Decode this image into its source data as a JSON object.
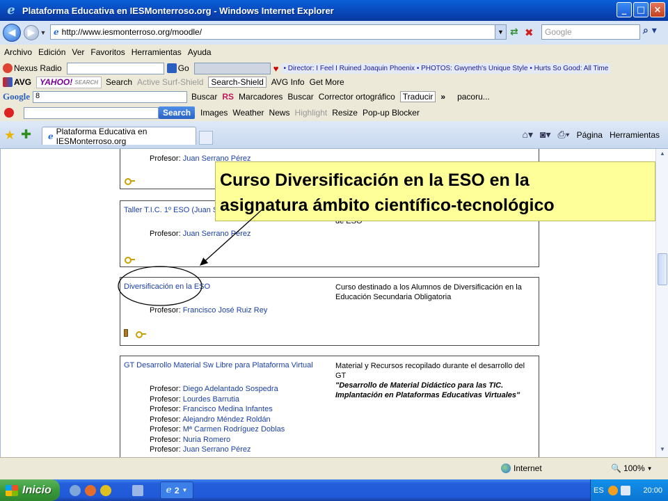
{
  "window": {
    "title": "Plataforma Educativa en IESMonterroso.org - Windows Internet Explorer",
    "buttons": {
      "minimize": "_",
      "maximize": "□",
      "close": "×"
    }
  },
  "address_bar": {
    "url": "http://www.iesmonterroso.org/moodle/",
    "search_placeholder": "Google"
  },
  "menu": [
    "Archivo",
    "Edición",
    "Ver",
    "Favoritos",
    "Herramientas",
    "Ayuda"
  ],
  "toolbar1": {
    "nexus": "Nexus Radio",
    "go": "Go",
    "ticker": "• Director: I Feel I Ruined Joaquin Phoenix • PHOTOS: Gwyneth's Unique Style • Hurts So Good: All Time"
  },
  "toolbar2": {
    "avg": "AVG",
    "yahoo": "YAHOO!",
    "search_hint": "SEARCH",
    "search": "Search",
    "active_surf_shield": "Active Surf-Shield",
    "search_shield": "Search-Shield",
    "avg_info": "AVG Info",
    "get_more": "Get More"
  },
  "toolbar3": {
    "google": "Google",
    "google_field": "8",
    "buscar": "Buscar",
    "rs": "RS",
    "marcadores": "Marcadores",
    "buscar2": "Buscar",
    "corrector": "Corrector ortográfico",
    "traducir": "Traducir",
    "more": "»",
    "user": "pacoru..."
  },
  "toolbar4": {
    "search_btn": "Search",
    "images": "Images",
    "weather": "Weather",
    "news": "News",
    "highlight": "Highlight",
    "resize": "Resize",
    "popup": "Pop-up Blocker"
  },
  "tab": {
    "label": "Plataforma Educativa en IESMonterroso.org"
  },
  "command_bar": {
    "pagina": "Página",
    "herramientas": "Herramientas"
  },
  "courses": [
    {
      "name": "",
      "desc": "",
      "teachers": [
        {
          "label": "Profesor",
          "name": "Juan Serrano Pérez"
        }
      ]
    },
    {
      "name": "Taller T.I.C. 1º ESO (Juan Ser",
      "desc": "de ESO",
      "teachers": [
        {
          "label": "Profesor",
          "name": "Juan Serrano Pérez"
        }
      ]
    },
    {
      "name": "Diversificación en la ESO",
      "desc": "Curso destinado a los Alumnos de Diversificación en la Educación Secundaria Obligatoria",
      "teachers": [
        {
          "label": "Profesor",
          "name": "Francisco José Ruiz Rey"
        }
      ]
    },
    {
      "name": "GT Desarrollo Material Sw Libre para Plataforma Virtual",
      "desc_plain": "Material y Recursos recopilado durante el desarrollo del GT",
      "desc_em": "\"Desarrollo de Material Didáctico para las TIC. Implantación en Plataformas Educativas Virtuales\"",
      "teachers": [
        {
          "label": "Profesor",
          "name": "Diego Adelantado Sospedra"
        },
        {
          "label": "Profesor",
          "name": "Lourdes Barrutia"
        },
        {
          "label": "Profesor",
          "name": "Francisco Medina Infantes"
        },
        {
          "label": "Profesor",
          "name": "Alejandro Méndez Roldán"
        },
        {
          "label": "Profesor",
          "name": "Mª Carmen Rodríguez Doblas"
        },
        {
          "label": "Profesor",
          "name": "Nuria Romero"
        },
        {
          "label": "Profesor",
          "name": "Juan Serrano Pérez"
        }
      ]
    }
  ],
  "callout": {
    "line1": "Curso Diversificación en la ESO en la",
    "line2": "asignatura ámbito científico-tecnológico"
  },
  "status": {
    "zone": "Internet",
    "zoom": "100%"
  },
  "taskbar": {
    "start": "Inicio",
    "group_count": "2",
    "lang": "ES",
    "clock": "20:00"
  },
  "colors": {
    "link": "#1a3fa8",
    "callout_bg": "#ffff99",
    "title_bar": "#0a5fd9"
  }
}
